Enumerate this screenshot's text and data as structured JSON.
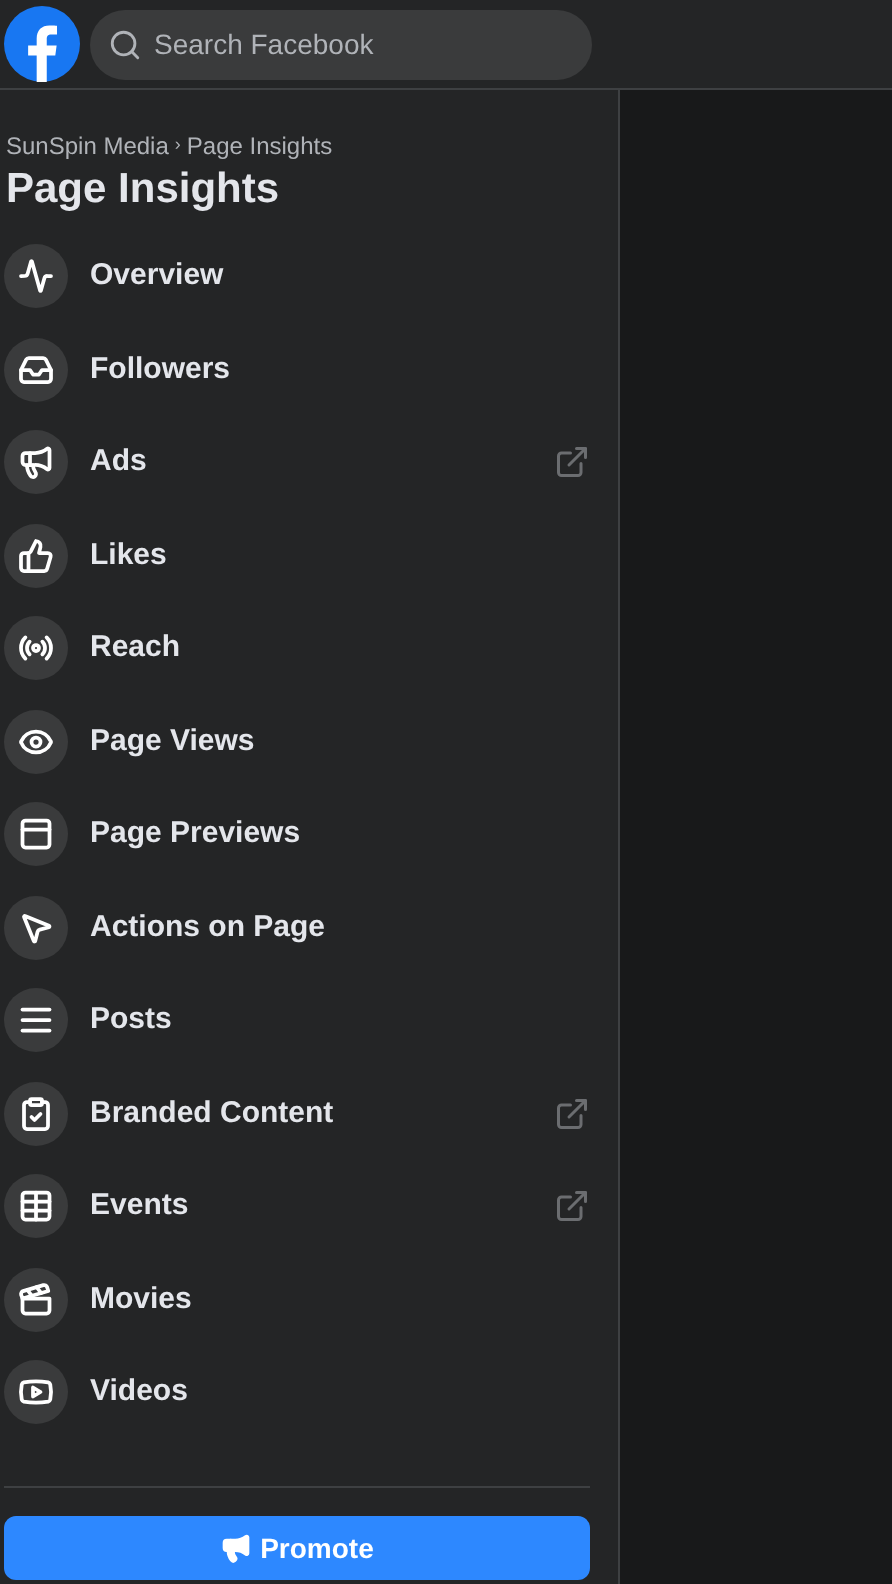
{
  "header": {
    "search": {
      "placeholder": "Search Facebook"
    }
  },
  "sidebar": {
    "breadcrumb": [
      "SunSpin Media",
      "Page Insights"
    ],
    "breadcrumb_separator": "›",
    "title": "Page Insights",
    "items": [
      {
        "label": "Overview",
        "external": false
      },
      {
        "label": "Followers",
        "external": false
      },
      {
        "label": "Ads",
        "external": true
      },
      {
        "label": "Likes",
        "external": false
      },
      {
        "label": "Reach",
        "external": false
      },
      {
        "label": "Page Views",
        "external": false
      },
      {
        "label": "Page Previews",
        "external": false
      },
      {
        "label": "Actions on Page",
        "external": false
      },
      {
        "label": "Posts",
        "external": false
      },
      {
        "label": "Branded Content",
        "external": true
      },
      {
        "label": "Events",
        "external": true
      },
      {
        "label": "Movies",
        "external": false
      },
      {
        "label": "Videos",
        "external": false
      }
    ],
    "promote_button": "Promote"
  }
}
